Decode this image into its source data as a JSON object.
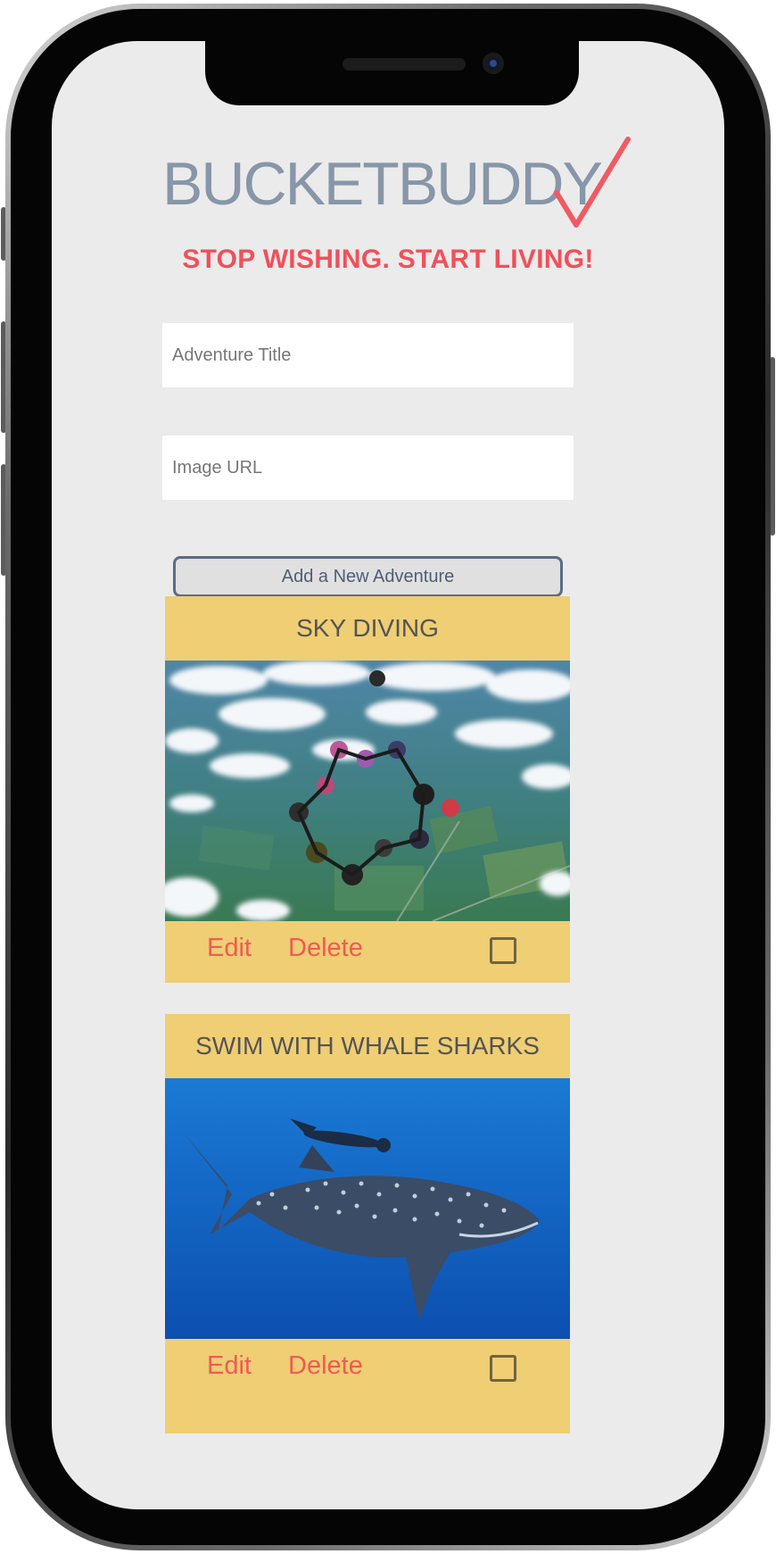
{
  "app": {
    "logo_text": "BUCKETBUDDY",
    "logo_colors": {
      "text": "#8796a8",
      "check": "#f05a64"
    },
    "tagline": "STOP WISHING. START LIVING!"
  },
  "form": {
    "title_placeholder": "Adventure Title",
    "url_placeholder": "Image URL",
    "submit_label": "Add a New Adventure"
  },
  "adventures": [
    {
      "title": "SKY DIVING",
      "image": "skydivers-formation-above-clouds",
      "edit_label": "Edit",
      "delete_label": "Delete",
      "completed": false
    },
    {
      "title": "SWIM WITH WHALE SHARKS",
      "image": "whale-shark-with-diver",
      "edit_label": "Edit",
      "delete_label": "Delete",
      "completed": false
    }
  ],
  "colors": {
    "screen_bg": "#ebebeb",
    "card_bg": "#efce74",
    "accent_red": "#f0505a",
    "button_border": "#5c6c84"
  }
}
